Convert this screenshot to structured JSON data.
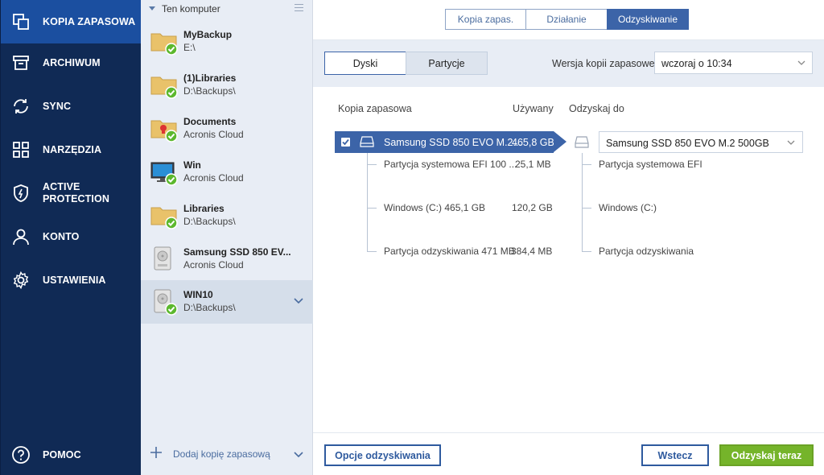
{
  "nav": {
    "items": [
      {
        "label": "KOPIA ZAPASOWA",
        "icon": "copy-icon",
        "active": true
      },
      {
        "label": "ARCHIWUM",
        "icon": "archive-icon"
      },
      {
        "label": "SYNC",
        "icon": "sync-icon"
      },
      {
        "label": "NARZĘDZIA",
        "icon": "tools-grid-icon"
      },
      {
        "label_line1": "ACTIVE",
        "label_line2": "PROTECTION",
        "icon": "shield-icon"
      },
      {
        "label": "KONTO",
        "icon": "user-icon"
      },
      {
        "label": "USTAWIENIA",
        "icon": "gear-icon"
      }
    ],
    "help": {
      "label": "POMOC",
      "icon": "help-icon"
    }
  },
  "backups": {
    "header": "Ten komputer",
    "items": [
      {
        "name": "MyBackup",
        "location": "E:\\",
        "icon": "folder-icon"
      },
      {
        "name": "(1)Libraries",
        "location": "D:\\Backups\\",
        "icon": "folder-icon"
      },
      {
        "name": "Documents",
        "location": "Acronis Cloud",
        "icon": "folder-lock-icon"
      },
      {
        "name": "Win",
        "location": "Acronis Cloud",
        "icon": "monitor-icon"
      },
      {
        "name": "Libraries",
        "location": "D:\\Backups\\",
        "icon": "folder-icon"
      },
      {
        "name": "Samsung SSD 850 EV...",
        "location": "Acronis Cloud",
        "icon": "hard-drive-icon"
      },
      {
        "name": "WIN10",
        "location": "D:\\Backups\\",
        "icon": "hard-drive-icon",
        "selected": true
      }
    ],
    "add_label": "Dodaj kopię zapasową"
  },
  "topbar": {
    "tabs": [
      "Kopia zapas.",
      "Działanie",
      "Odzyskiwanie"
    ],
    "active_tab": "Odzyskiwanie"
  },
  "recovery": {
    "subtabs": [
      "Dyski",
      "Partycje"
    ],
    "active_subtab": "Dyski",
    "version_label": "Wersja kopii zapasowej:",
    "version_value": "wczoraj o 10:34",
    "columns": {
      "backup": "Kopia zapasowa",
      "used": "Używany",
      "restore_to": "Odzyskaj do"
    },
    "disk": {
      "name": "Samsung SSD 850 EVO M.2...",
      "size": "465,8 GB",
      "checked": true
    },
    "partitions": [
      {
        "name": "Partycja systemowa EFI 100 ...",
        "size": "25,1 MB",
        "target": "Partycja systemowa EFI"
      },
      {
        "name": "Windows (C:) 465,1 GB",
        "size": "120,2 GB",
        "target": "Windows (C:)"
      },
      {
        "name": "Partycja odzyskiwania 471 MB",
        "size": "384,4 MB",
        "target": "Partycja odzyskiwania"
      }
    ],
    "target_disk": "Samsung SSD 850 EVO M.2 500GB"
  },
  "footer": {
    "options_label": "Opcje odzyskiwania",
    "back_label": "Wstecz",
    "recover_label": "Odzyskaj teraz"
  },
  "colors": {
    "nav_bg": "#102a55",
    "nav_active": "#1b4fa0",
    "accent": "#3c64a8",
    "success": "#75b42a"
  }
}
